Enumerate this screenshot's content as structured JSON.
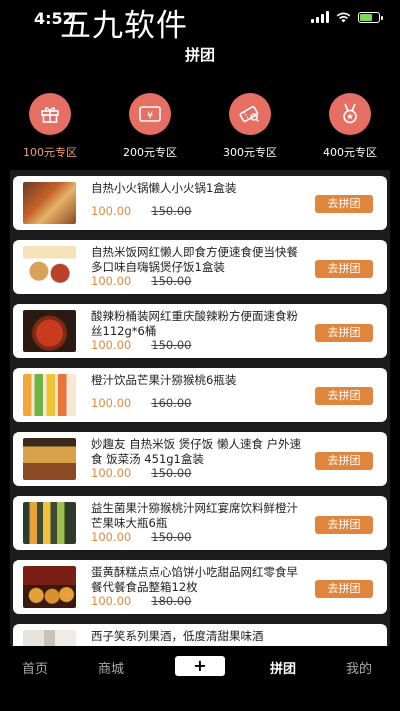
{
  "status": {
    "time": "4:52"
  },
  "watermark": "五九软件",
  "header": {
    "title": "拼团"
  },
  "categories": [
    {
      "label": "100元专区",
      "icon": "gift-icon",
      "active": true
    },
    {
      "label": "200元专区",
      "icon": "yen-icon",
      "active": false
    },
    {
      "label": "300元专区",
      "icon": "ticket-icon",
      "active": false
    },
    {
      "label": "400元专区",
      "icon": "medal-icon",
      "active": false
    }
  ],
  "products": [
    {
      "name": "自热小火锅懒人小火锅1盒装",
      "price": "100.00",
      "original": "150.00",
      "button": "去拼团"
    },
    {
      "name": "自热米饭网红懒人即食方便速食便当快餐多口味自嗨锅煲仔饭1盒装",
      "price": "100.00",
      "original": "150.00",
      "button": "去拼团"
    },
    {
      "name": "酸辣粉桶装网红重庆酸辣粉方便面速食粉丝112g*6桶",
      "price": "100.00",
      "original": "150.00",
      "button": "去拼团"
    },
    {
      "name": "橙汁饮品芒果汁猕猴桃6瓶装",
      "price": "100.00",
      "original": "160.00",
      "button": "去拼团"
    },
    {
      "name": "妙趣友 自热米饭 煲仔饭 懒人速食 户外速食 饭菜汤 451g1盒装",
      "price": "100.00",
      "original": "150.00",
      "button": "去拼团"
    },
    {
      "name": "益生菌果汁猕猴桃汁网红宴席饮料鲜橙汁芒果味大瓶6瓶",
      "price": "100.00",
      "original": "150.00",
      "button": "去拼团"
    },
    {
      "name": "蛋黄酥糕点点心馅饼小吃甜品网红零食早餐代餐食品整箱12枚",
      "price": "100.00",
      "original": "180.00",
      "button": "去拼团"
    },
    {
      "name": "西子笑系列果酒，低度清甜果味酒",
      "price": "",
      "original": "",
      "button": ""
    }
  ],
  "tabbar": {
    "home": "首页",
    "mall": "商城",
    "plus": "+",
    "group": "拼团",
    "mine": "我的"
  }
}
